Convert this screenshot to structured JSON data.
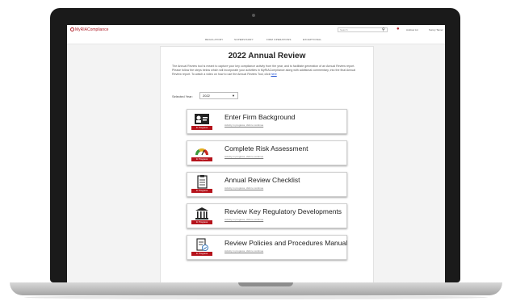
{
  "app": {
    "logo_text": "MyRIACompliance",
    "search_placeholder": "Search",
    "user_name": "Andrew Lin",
    "user_menu": "Sunny Tamer"
  },
  "nav": {
    "items": [
      "REGULATORY",
      "SUPERVISORY",
      "FIRM OPERATIONS",
      "EXCEPTIONAL"
    ]
  },
  "page": {
    "title": "2022 Annual Review",
    "intro": "The Annual Review tool is meant to capture your key compliance activity from the year, and to facilitate generation of an Annual Review report. Please follow the steps below which will incorporate your activities in MyRIACompliance along with additional commentary, into the final Annual Review report. To watch a video on how to use the Annual Review Tool, click",
    "intro_link": "here",
    "year_label": "Selected Year:",
    "year_value": "2022"
  },
  "cards": [
    {
      "title": "Enter Firm Background",
      "link": "Activity in progress, click to continue",
      "badge": "In Progress",
      "icon": "id-card-icon"
    },
    {
      "title": "Complete Risk Assessment",
      "link": "Activity in progress, click to continue",
      "badge": "In Progress",
      "icon": "gauge-icon"
    },
    {
      "title": "Annual Review Checklist",
      "link": "Activity in progress, click to continue",
      "badge": "In Progress",
      "icon": "clipboard-icon"
    },
    {
      "title": "Review Key Regulatory Developments",
      "link": "Activity in progress, click to continue",
      "badge": "In Progress",
      "icon": "building-icon"
    },
    {
      "title": "Review Policies and Procedures Manual",
      "link": "Activity in progress, click to continue",
      "badge": "In Progress",
      "icon": "document-check-icon"
    }
  ],
  "colors": {
    "accent": "#b5121b",
    "link": "#1a4cd1"
  }
}
